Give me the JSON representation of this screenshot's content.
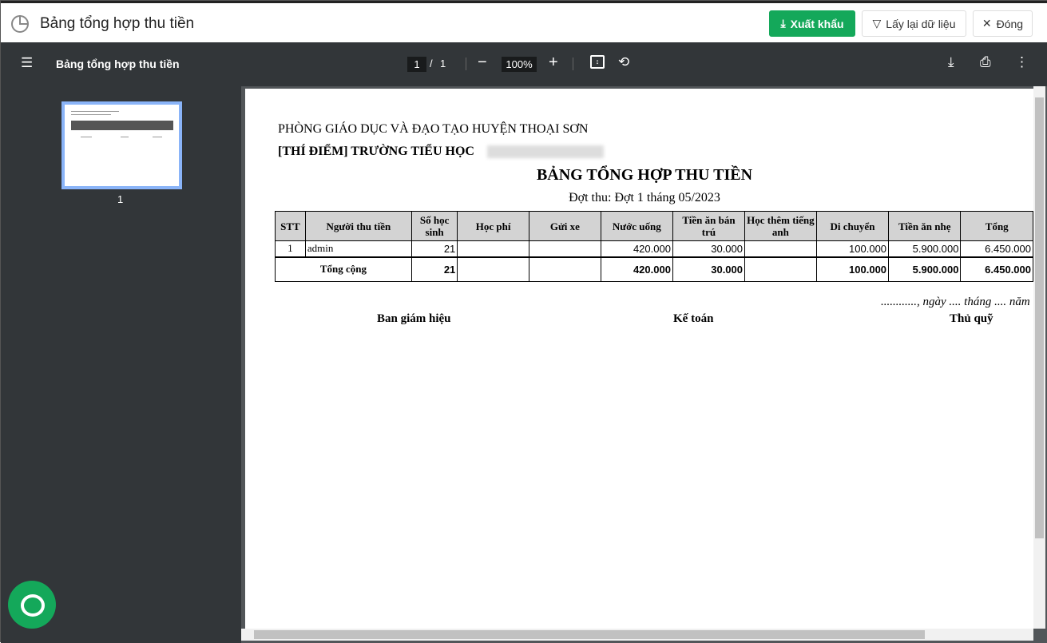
{
  "header": {
    "title": "Bảng tổng hợp thu tiền",
    "export_label": "Xuất khẩu",
    "reload_label": "Lấy lại dữ liệu",
    "close_label": "Đóng"
  },
  "pdf_toolbar": {
    "title": "Bảng tổng hợp thu tiền",
    "page_current": "1",
    "page_sep": "/",
    "page_total": "1",
    "zoom": "100%"
  },
  "sidebar": {
    "thumb_page": "1"
  },
  "document": {
    "org": "PHÒNG GIÁO DỤC VÀ ĐẠO TẠO HUYỆN THOẠI SƠN",
    "school": "[THÍ ĐIỂM] TRƯỜNG TIỂU HỌC",
    "title": "BẢNG TỔNG HỢP THU TIỀN",
    "subtitle": "Đợt thu: Đợt 1 tháng 05/2023",
    "columns": [
      "STT",
      "Người thu tiền",
      "Số học sinh",
      "Học phí",
      "Gửi xe",
      "Nước uống",
      "Tiền ăn bán trú",
      "Học thêm tiếng anh",
      "Di chuyển",
      "Tiền ăn nhẹ",
      "Tổng"
    ],
    "rows": [
      [
        "1",
        "admin",
        "21",
        "",
        "",
        "420.000",
        "30.000",
        "",
        "100.000",
        "5.900.000",
        "6.450.000"
      ]
    ],
    "total": {
      "label": "Tổng cộng",
      "values": [
        "21",
        "",
        "",
        "420.000",
        "30.000",
        "",
        "100.000",
        "5.900.000",
        "6.450.000"
      ]
    },
    "date_line": "............, ngày .... tháng .... năm",
    "signers": [
      "Ban giám hiệu",
      "Kế toán",
      "Thủ quỹ"
    ]
  }
}
